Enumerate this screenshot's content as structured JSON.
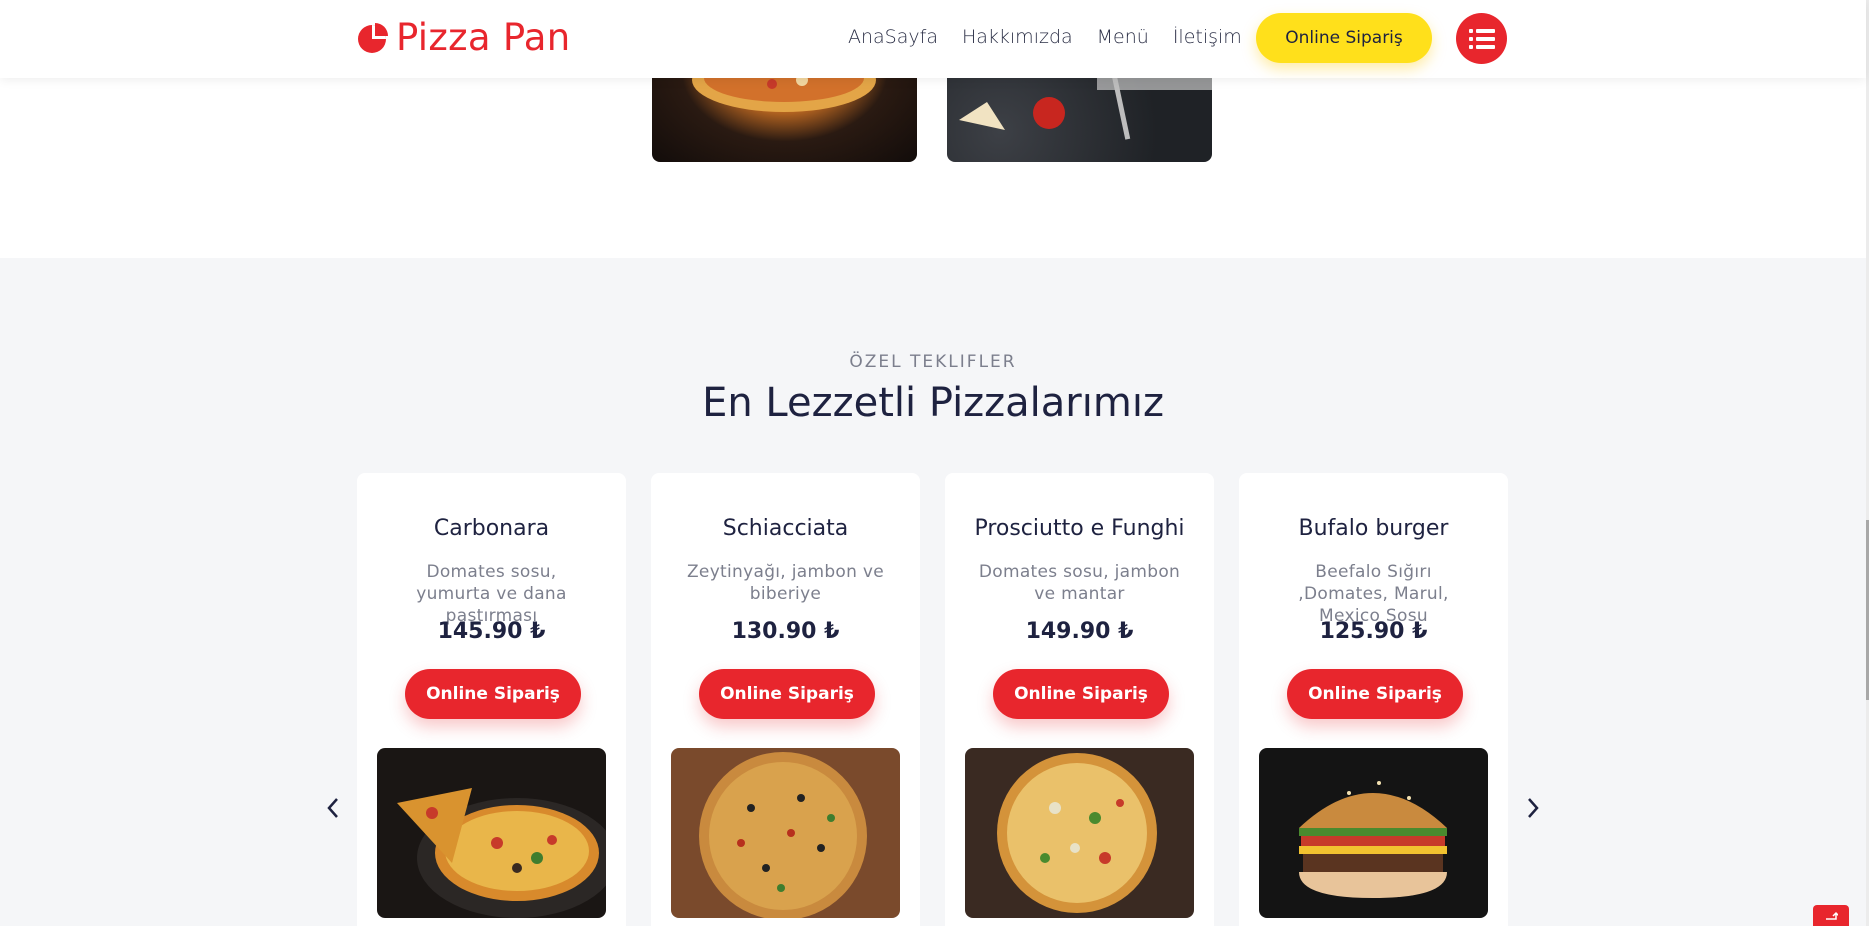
{
  "header": {
    "logo_text": "Pizza Pan",
    "nav": [
      "AnaSayfa",
      "Hakkımızda",
      "Menü",
      "İletişim"
    ],
    "order_button": "Online Sipariş",
    "menu_icon": "list-icon"
  },
  "section": {
    "eyebrow": "ÖZEL TEKLIFLER",
    "title": "En Lezzetli Pizzalarımız"
  },
  "cards": [
    {
      "name": "Carbonara",
      "desc": "Domates sosu, yumurta ve dana pastırması",
      "price": "145.90 ₺",
      "button": "Online Sipariş"
    },
    {
      "name": "Schiacciata",
      "desc": "Zeytinyağı, jambon ve biberiye",
      "price": "130.90 ₺",
      "button": "Online Sipariş"
    },
    {
      "name": "Prosciutto e Funghi",
      "desc": "Domates sosu, jambon ve mantar",
      "price": "149.90 ₺",
      "button": "Online Sipariş"
    },
    {
      "name": "Bufalo burger",
      "desc": "Beefalo Sığırı ,Domates, Marul, Mexico Sosu",
      "price": "125.90 ₺",
      "button": "Online Sipariş"
    }
  ],
  "colors": {
    "brand_red": "#e8262d",
    "brand_yellow": "#ffe01b",
    "text_dark": "#1e2240"
  }
}
